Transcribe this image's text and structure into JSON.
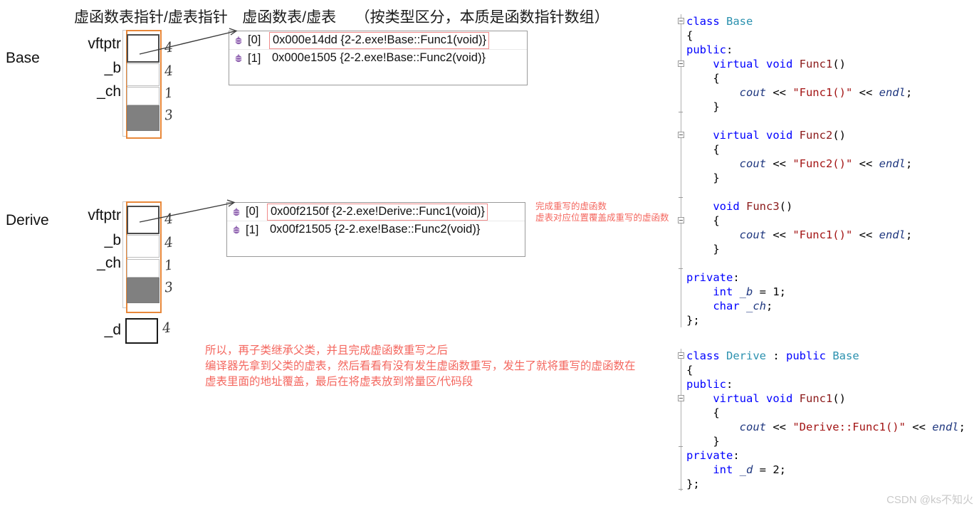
{
  "title": {
    "part1": "虚函数表指针/虚表指针",
    "part2": "虚函数表/虚表",
    "part3": "（按类型区分，本质是函数指针数组）"
  },
  "objects": [
    {
      "class_label": "Base",
      "fields": [
        {
          "label": "vftptr",
          "size": "4"
        },
        {
          "label": "_b",
          "size": "4"
        },
        {
          "label": "_ch",
          "size": "1"
        },
        {
          "label": "",
          "size": "3"
        }
      ]
    },
    {
      "class_label": "Derive",
      "fields": [
        {
          "label": "vftptr",
          "size": "4"
        },
        {
          "label": "_b",
          "size": "4"
        },
        {
          "label": "_ch",
          "size": "1"
        },
        {
          "label": "",
          "size": "3"
        },
        {
          "label": "_d",
          "size": "4"
        }
      ]
    }
  ],
  "vtables": [
    {
      "name": "base-vtable",
      "rows": [
        {
          "index": "[0]",
          "value": "0x000e14dd {2-2.exe!Base::Func1(void)}",
          "highlight": true
        },
        {
          "index": "[1]",
          "value": "0x000e1505 {2-2.exe!Base::Func2(void)}",
          "highlight": false
        }
      ]
    },
    {
      "name": "derive-vtable",
      "rows": [
        {
          "index": "[0]",
          "value": "0x00f2150f {2-2.exe!Derive::Func1(void)}",
          "highlight": true
        },
        {
          "index": "[1]",
          "value": "0x00f21505 {2-2.exe!Base::Func2(void)}",
          "highlight": false
        }
      ]
    }
  ],
  "annotations": {
    "overwrite_note_line1": "完成重写的虚函数",
    "overwrite_note_line2": "虚表对应位置覆盖成重写的虚函数",
    "summary_line1": "所以，再子类继承父类，并且完成虚函数重写之后",
    "summary_line2": "编译器先拿到父类的虚表，然后看看有没有发生虚函数重写，发生了就将重写的虚函数在",
    "summary_line3": "虚表里面的地址覆盖，最后在将虚表放到常量区/代码段"
  },
  "code": {
    "base": [
      [
        {
          "t": "class ",
          "c": "kw"
        },
        {
          "t": "Base",
          "c": "typ"
        }
      ],
      [
        {
          "t": "{",
          "c": "pl"
        }
      ],
      [
        {
          "t": "public",
          "c": "kw"
        },
        {
          "t": ":",
          "c": "pl"
        }
      ],
      [
        {
          "t": "    ",
          "c": "pl"
        },
        {
          "t": "virtual ",
          "c": "kw"
        },
        {
          "t": "void ",
          "c": "kw"
        },
        {
          "t": "Func1",
          "c": "fn"
        },
        {
          "t": "()",
          "c": "pl"
        }
      ],
      [
        {
          "t": "    {",
          "c": "pl"
        }
      ],
      [
        {
          "t": "        ",
          "c": "pl"
        },
        {
          "t": "cout",
          "c": "var"
        },
        {
          "t": " << ",
          "c": "op"
        },
        {
          "t": "\"Func1()\"",
          "c": "str"
        },
        {
          "t": " << ",
          "c": "op"
        },
        {
          "t": "endl",
          "c": "var"
        },
        {
          "t": ";",
          "c": "pl"
        }
      ],
      [
        {
          "t": "    }",
          "c": "pl"
        }
      ],
      [
        {
          "t": "",
          "c": "pl"
        }
      ],
      [
        {
          "t": "    ",
          "c": "pl"
        },
        {
          "t": "virtual ",
          "c": "kw"
        },
        {
          "t": "void ",
          "c": "kw"
        },
        {
          "t": "Func2",
          "c": "fn"
        },
        {
          "t": "()",
          "c": "pl"
        }
      ],
      [
        {
          "t": "    {",
          "c": "pl"
        }
      ],
      [
        {
          "t": "        ",
          "c": "pl"
        },
        {
          "t": "cout",
          "c": "var"
        },
        {
          "t": " << ",
          "c": "op"
        },
        {
          "t": "\"Func2()\"",
          "c": "str"
        },
        {
          "t": " << ",
          "c": "op"
        },
        {
          "t": "endl",
          "c": "var"
        },
        {
          "t": ";",
          "c": "pl"
        }
      ],
      [
        {
          "t": "    }",
          "c": "pl"
        }
      ],
      [
        {
          "t": "",
          "c": "pl"
        }
      ],
      [
        {
          "t": "    ",
          "c": "pl"
        },
        {
          "t": "void ",
          "c": "kw"
        },
        {
          "t": "Func3",
          "c": "fn"
        },
        {
          "t": "()",
          "c": "pl"
        }
      ],
      [
        {
          "t": "    {",
          "c": "pl"
        }
      ],
      [
        {
          "t": "        ",
          "c": "pl"
        },
        {
          "t": "cout",
          "c": "var"
        },
        {
          "t": " << ",
          "c": "op"
        },
        {
          "t": "\"Func1()\"",
          "c": "str"
        },
        {
          "t": " << ",
          "c": "op"
        },
        {
          "t": "endl",
          "c": "var"
        },
        {
          "t": ";",
          "c": "pl"
        }
      ],
      [
        {
          "t": "    }",
          "c": "pl"
        }
      ],
      [
        {
          "t": "",
          "c": "pl"
        }
      ],
      [
        {
          "t": "private",
          "c": "kw"
        },
        {
          "t": ":",
          "c": "pl"
        }
      ],
      [
        {
          "t": "    ",
          "c": "pl"
        },
        {
          "t": "int ",
          "c": "kw"
        },
        {
          "t": "_b",
          "c": "var"
        },
        {
          "t": " = ",
          "c": "op"
        },
        {
          "t": "1",
          "c": "pl"
        },
        {
          "t": ";",
          "c": "pl"
        }
      ],
      [
        {
          "t": "    ",
          "c": "pl"
        },
        {
          "t": "char ",
          "c": "kw"
        },
        {
          "t": "_ch",
          "c": "var"
        },
        {
          "t": ";",
          "c": "pl"
        }
      ],
      [
        {
          "t": "};",
          "c": "pl"
        }
      ]
    ],
    "derive": [
      [
        {
          "t": "class ",
          "c": "kw"
        },
        {
          "t": "Derive",
          "c": "typ"
        },
        {
          "t": " : ",
          "c": "pl"
        },
        {
          "t": "public ",
          "c": "kw"
        },
        {
          "t": "Base",
          "c": "typ"
        }
      ],
      [
        {
          "t": "{",
          "c": "pl"
        }
      ],
      [
        {
          "t": "public",
          "c": "kw"
        },
        {
          "t": ":",
          "c": "pl"
        }
      ],
      [
        {
          "t": "    ",
          "c": "pl"
        },
        {
          "t": "virtual ",
          "c": "kw"
        },
        {
          "t": "void ",
          "c": "kw"
        },
        {
          "t": "Func1",
          "c": "fn"
        },
        {
          "t": "()",
          "c": "pl"
        }
      ],
      [
        {
          "t": "    {",
          "c": "pl"
        }
      ],
      [
        {
          "t": "        ",
          "c": "pl"
        },
        {
          "t": "cout",
          "c": "var"
        },
        {
          "t": " << ",
          "c": "op"
        },
        {
          "t": "\"Derive::Func1()\"",
          "c": "str"
        },
        {
          "t": " << ",
          "c": "op"
        },
        {
          "t": "endl",
          "c": "var"
        },
        {
          "t": ";",
          "c": "pl"
        }
      ],
      [
        {
          "t": "    }",
          "c": "pl"
        }
      ],
      [
        {
          "t": "private",
          "c": "kw"
        },
        {
          "t": ":",
          "c": "pl"
        }
      ],
      [
        {
          "t": "    ",
          "c": "pl"
        },
        {
          "t": "int ",
          "c": "kw"
        },
        {
          "t": "_d",
          "c": "var"
        },
        {
          "t": " = ",
          "c": "op"
        },
        {
          "t": "2",
          "c": "pl"
        },
        {
          "t": ";",
          "c": "pl"
        }
      ],
      [
        {
          "t": "};",
          "c": "pl"
        }
      ]
    ]
  },
  "watermark": "CSDN @ks不知火"
}
